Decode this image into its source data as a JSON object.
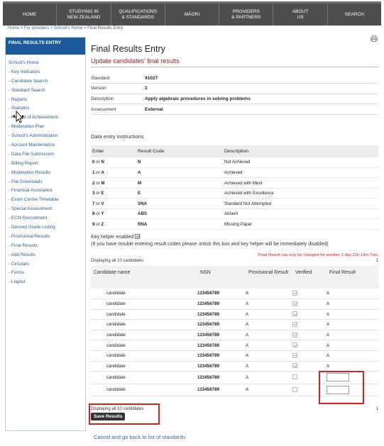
{
  "nav": {
    "items": [
      {
        "label": "HOME"
      },
      {
        "label": "STUDYING IN\nNEW ZEALAND"
      },
      {
        "label": "QUALIFICATIONS\n& STANDARDS"
      },
      {
        "label": "MĀORI"
      },
      {
        "label": "PROVIDERS\n& PARTNERS"
      },
      {
        "label": "ABOUT\nUS"
      },
      {
        "label": "SEARCH"
      }
    ]
  },
  "breadcrumb": {
    "home": "Home",
    "providers": "For providers",
    "school_home": "School's Home",
    "current": "Final Results Entry",
    "sep": " > "
  },
  "sidebar": {
    "title": "FINAL RESULTS ENTRY",
    "items": [
      "School's Home",
      "- Key Indicators",
      "- Candidate Search",
      "- Standard Search",
      "- Reports",
      "- Statistics",
      "- Record of Achievement",
      "- Moderation Plan",
      "- School's Administration",
      "- Account Maintenance",
      "- Data File Submission",
      "- Billing Report",
      "- Moderation Results",
      "- File Downloads",
      "- Financial Assistance",
      "- Exam Centre Timetable",
      "- Special Assessment",
      "- ECM Recruitment",
      "- Derived Grade Listing",
      "- Provisional Results",
      "- Final Results",
      "- Add Results",
      "- Circulars",
      "- Forms",
      "- Logout"
    ]
  },
  "main": {
    "title": "Final Results Entry",
    "subtitle": "Update candidates' final results",
    "info": [
      {
        "key": "Standard",
        "value": "91027"
      },
      {
        "key": "Version",
        "value": "2"
      },
      {
        "key": "Description",
        "value": "Apply algebraic procedures in solving problems"
      },
      {
        "key": "Assessment",
        "value": "External"
      }
    ],
    "instructions_label": "Data entry instructions",
    "codes_header": {
      "enter": "Enter",
      "code": "Result Code",
      "desc": "Description"
    },
    "codes": [
      {
        "k1": "0",
        "or": " or ",
        "k2": "N",
        "code": "N",
        "desc": "Not Achieved"
      },
      {
        "k1": "1",
        "or": " or ",
        "k2": "A",
        "code": "A",
        "desc": "Achieved"
      },
      {
        "k1": "2",
        "or": " or ",
        "k2": "M",
        "code": "M",
        "desc": "Achieved with Merit"
      },
      {
        "k1": "3",
        "or": " or ",
        "k2": "E",
        "code": "E",
        "desc": "Achieved with Excellence"
      },
      {
        "k1": "7",
        "or": " or ",
        "k2": "V",
        "code": "SNA",
        "desc": "Standard Not Attempted"
      },
      {
        "k1": "8",
        "or": " or ",
        "k2": "Y",
        "code": "ABS",
        "desc": "Absent"
      },
      {
        "k1": "9",
        "or": " or ",
        "k2": "Z",
        "code": "RNA",
        "desc": "Missing Paper"
      }
    ],
    "key_helper_label": "Key helper enabled",
    "key_helper_note": "(If you have trouble entering result codes please untick this box and key helper will be immediately disabled)",
    "deadline": "Final Result can only be changed for another 1 day 21h:13m:7sec",
    "displaying": "Displaying all 10 candidates",
    "page_number": "1",
    "cand_header": {
      "name": "Candidate name",
      "nsn": "NSN",
      "prov": "Provisional Result",
      "verified": "Verified",
      "final": "Final Result"
    },
    "candidates": [
      {
        "name": "candidate",
        "nsn": "123456789",
        "prov": "A",
        "final": "A"
      },
      {
        "name": "candidate",
        "nsn": "123456789",
        "prov": "A",
        "final": "A"
      },
      {
        "name": "candidate",
        "nsn": "123456789",
        "prov": "A",
        "final": "A"
      },
      {
        "name": "candidate",
        "nsn": "123456789",
        "prov": "A",
        "final": "A"
      },
      {
        "name": "candidate",
        "nsn": "123456789",
        "prov": "A",
        "final": "A"
      },
      {
        "name": "candidate",
        "nsn": "123456789",
        "prov": "A",
        "final": "A"
      },
      {
        "name": "candidate",
        "nsn": "123456789",
        "prov": "A",
        "final": "A"
      },
      {
        "name": "candidate",
        "nsn": "123456789",
        "prov": "A",
        "final": "A"
      },
      {
        "name": "candidate",
        "nsn": "123456789",
        "prov": "A",
        "final": ""
      },
      {
        "name": "candidate",
        "nsn": "123456789",
        "prov": "A",
        "final": ""
      }
    ],
    "save_button": "Save Results",
    "cancel_link": "Cancel and go back to list of standards"
  },
  "colors": {
    "accent": "#1d5a99",
    "highlight": "#d92020",
    "nav_bg": "#4e4e4e",
    "subtitle": "#a11c1c"
  }
}
